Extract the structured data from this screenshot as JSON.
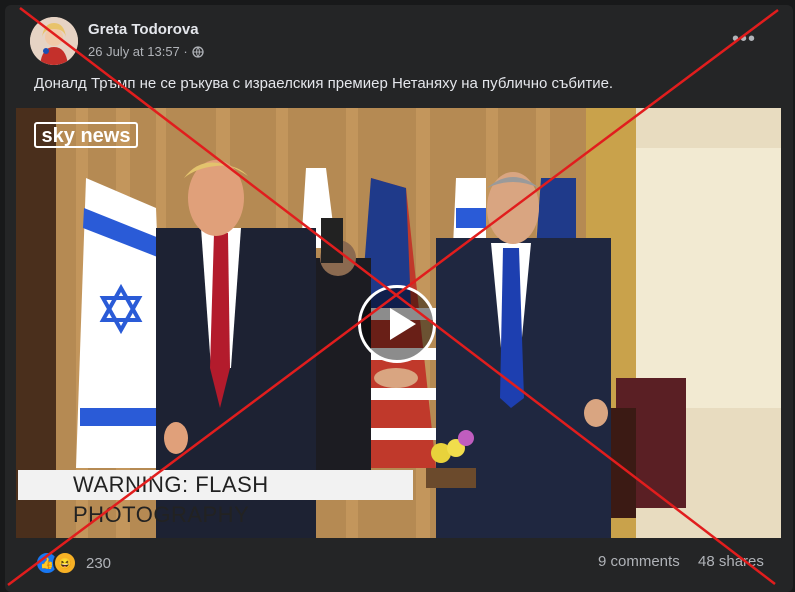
{
  "post": {
    "author": "Greta Todorova",
    "date": "26 July at 13:57 ·",
    "privacy_icon": "globe-icon",
    "more_label": "•••",
    "caption": "Доналд Тръмп не се ръкува с израелския премиер Нетаняху на публично събитие."
  },
  "video": {
    "logo_text": "sky news",
    "banner_text": "WARNING: FLASH PHOTOGRAPHY"
  },
  "footer": {
    "reaction_icons": [
      "like-icon",
      "haha-icon"
    ],
    "reaction_count": "230",
    "comments": "9 comments",
    "shares": "48 shares"
  },
  "colors": {
    "background": "#18191a",
    "card": "#242526",
    "text": "#e4e6eb",
    "muted": "#b0b3b8",
    "cross": "#e11d1d"
  }
}
